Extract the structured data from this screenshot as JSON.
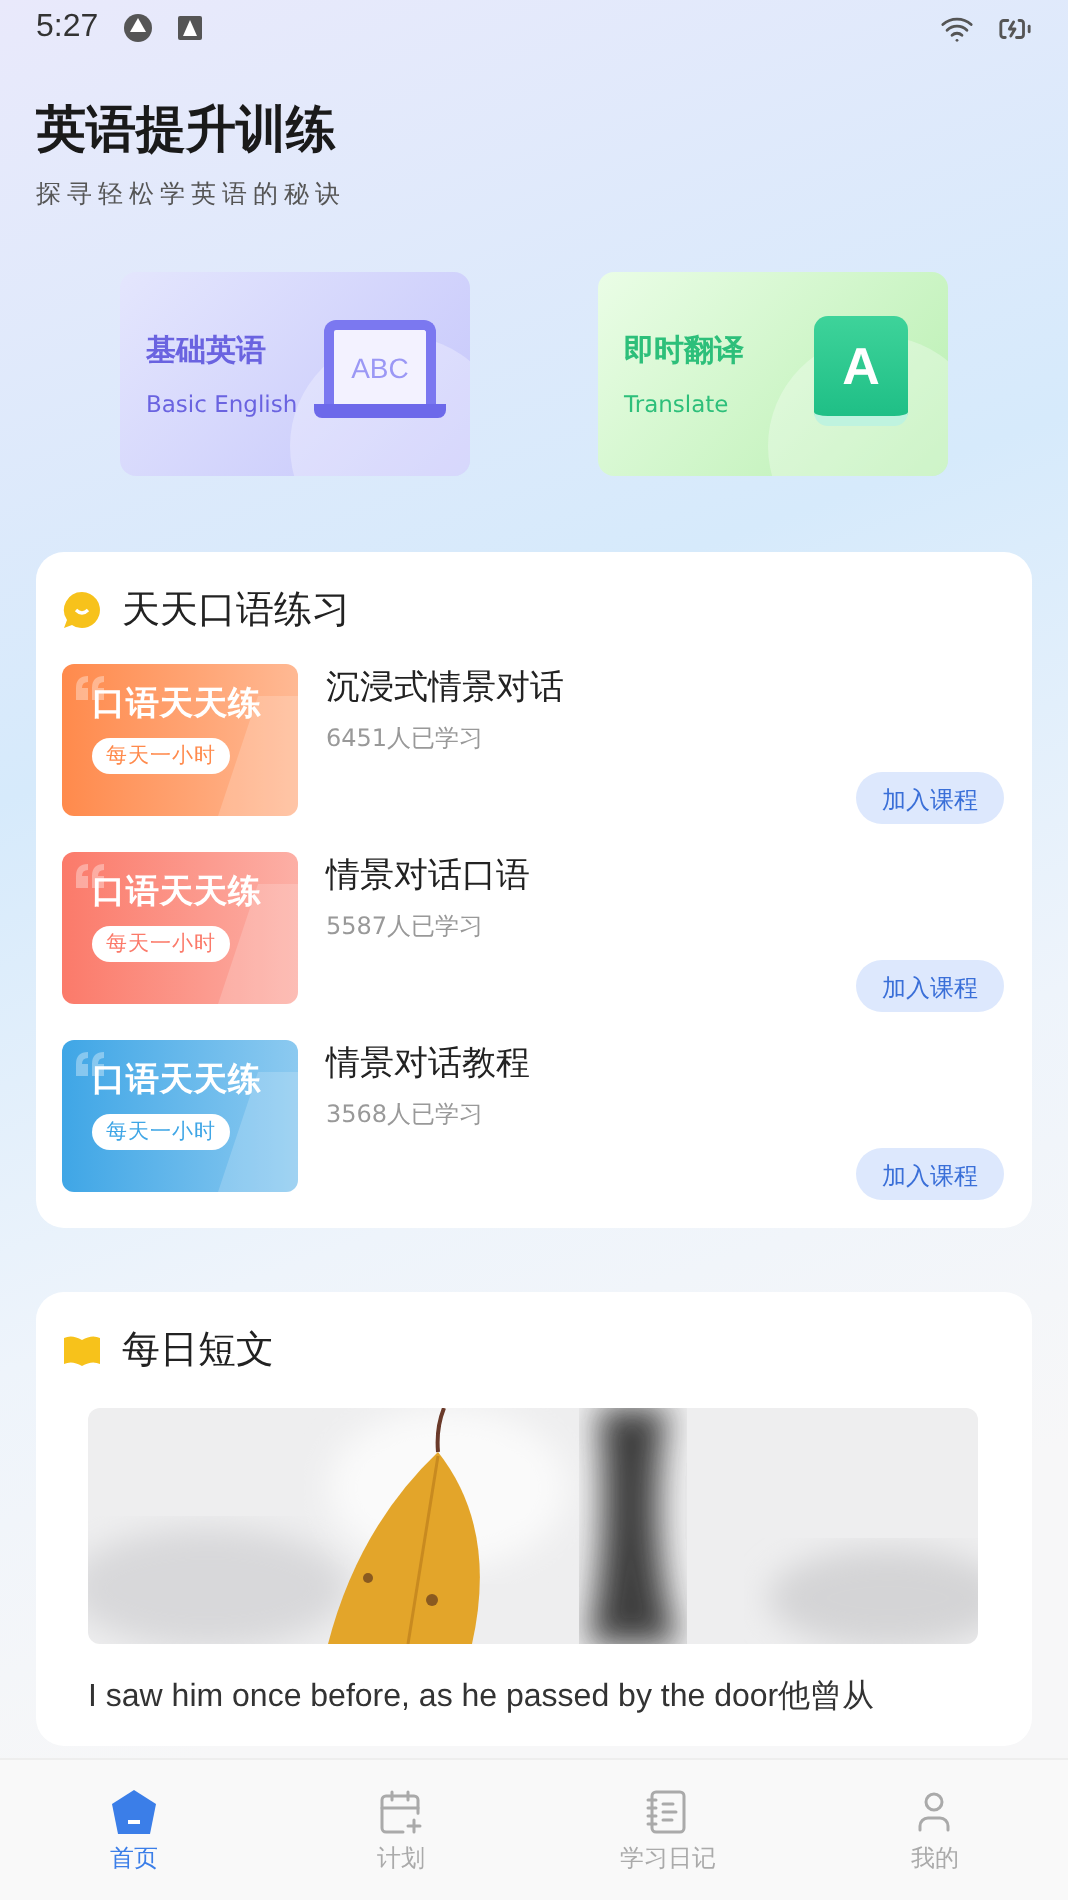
{
  "status_bar": {
    "time": "5:27"
  },
  "header": {
    "title": "英语提升训练",
    "subtitle": "探寻轻松学英语的秘诀"
  },
  "feature_cards": [
    {
      "kind": "laptop",
      "title": "基础英语",
      "subtitle": "Basic English",
      "icon_text": "ABC"
    },
    {
      "kind": "book",
      "title": "即时翻译",
      "subtitle": "Translate",
      "icon_text": "A"
    }
  ],
  "practice": {
    "title": "天天口语练习",
    "courses": [
      {
        "thumb_title": "口语天天练",
        "thumb_badge": "每天一小时",
        "color": "#ff8a4c",
        "name": "沉浸式情景对话",
        "learners": "6451人已学习",
        "button": "加入课程"
      },
      {
        "thumb_title": "口语天天练",
        "thumb_badge": "每天一小时",
        "color": "#fb7a6a",
        "name": "情景对话口语",
        "learners": "5587人已学习",
        "button": "加入课程"
      },
      {
        "thumb_title": "口语天天练",
        "thumb_badge": "每天一小时",
        "color": "#3fa6e6",
        "name": "情景对话教程",
        "learners": "3568人已学习",
        "button": "加入课程"
      }
    ]
  },
  "daily": {
    "title": "每日短文",
    "text": "I saw him once before, as he passed by the door他曾从"
  },
  "tabs": [
    {
      "label": "首页",
      "selected": true
    },
    {
      "label": "计划",
      "selected": false
    },
    {
      "label": "学习日记",
      "selected": false
    },
    {
      "label": "我的",
      "selected": false
    }
  ]
}
